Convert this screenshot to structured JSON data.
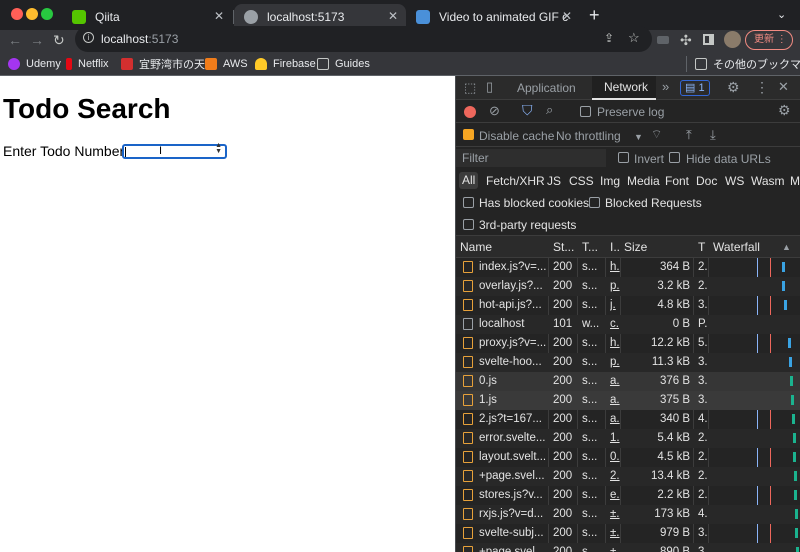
{
  "browser": {
    "tabs": [
      {
        "title": "Qiita",
        "active": false
      },
      {
        "title": "localhost:5173",
        "active": true
      },
      {
        "title": "Video to animated GIF convert",
        "active": false
      }
    ],
    "new_tab": "+",
    "address": {
      "host": "localhost",
      "port": ":5173"
    },
    "update_button": "更新",
    "bookmarks": [
      "Udemy",
      "Netflix",
      "宜野湾市の天気",
      "AWS",
      "Firebase",
      "Guides"
    ],
    "other_bookmarks": "その他のブックマーク"
  },
  "page": {
    "title": "Todo Search",
    "label": "Enter Todo Number:"
  },
  "devtools": {
    "tabs": {
      "application": "Application",
      "network": "Network",
      "more": "»",
      "messages_count": "1"
    },
    "toolbar": {
      "preserve_log": "Preserve log",
      "disable_cache": "Disable cache",
      "throttling": "No throttling"
    },
    "filter": {
      "placeholder": "Filter",
      "invert": "Invert",
      "hide_data_urls": "Hide data URLs"
    },
    "types": [
      "All",
      "Fetch/XHR",
      "JS",
      "CSS",
      "Img",
      "Media",
      "Font",
      "Doc",
      "WS",
      "Wasm",
      "M"
    ],
    "blocked_cookies": "Has blocked cookies",
    "blocked_requests": "Blocked Requests",
    "third_party": "3rd-party requests",
    "columns": {
      "name": "Name",
      "status": "St...",
      "type": "T...",
      "initiator": "I...",
      "size": "Size",
      "time": "T",
      "waterfall": "Waterfall"
    },
    "requests": [
      {
        "name": "index.js?v=...",
        "status": "200",
        "type": "s...",
        "initiator": "h.",
        "size": "364 B",
        "time": "2."
      },
      {
        "name": "overlay.js?...",
        "status": "200",
        "type": "s...",
        "initiator": "p.",
        "size": "3.2 kB",
        "time": "2."
      },
      {
        "name": "hot-api.js?...",
        "status": "200",
        "type": "s...",
        "initiator": "j.",
        "size": "4.8 kB",
        "time": "3."
      },
      {
        "name": "localhost",
        "status": "101",
        "type": "w...",
        "initiator": "c.",
        "size": "0 B",
        "time": "P."
      },
      {
        "name": "proxy.js?v=...",
        "status": "200",
        "type": "s...",
        "initiator": "h.",
        "size": "12.2 kB",
        "time": "5."
      },
      {
        "name": "svelte-hoo...",
        "status": "200",
        "type": "s...",
        "initiator": "p.",
        "size": "11.3 kB",
        "time": "3."
      },
      {
        "name": "0.js",
        "status": "200",
        "type": "s...",
        "initiator": "a.",
        "size": "376 B",
        "time": "3."
      },
      {
        "name": "1.js",
        "status": "200",
        "type": "s...",
        "initiator": "a.",
        "size": "375 B",
        "time": "3."
      },
      {
        "name": "2.js?t=167...",
        "status": "200",
        "type": "s...",
        "initiator": "a.",
        "size": "340 B",
        "time": "4."
      },
      {
        "name": "error.svelte...",
        "status": "200",
        "type": "s...",
        "initiator": "1.",
        "size": "5.4 kB",
        "time": "2."
      },
      {
        "name": "layout.svelt...",
        "status": "200",
        "type": "s...",
        "initiator": "0.",
        "size": "4.5 kB",
        "time": "2."
      },
      {
        "name": "+page.svel...",
        "status": "200",
        "type": "s...",
        "initiator": "2.",
        "size": "13.4 kB",
        "time": "2."
      },
      {
        "name": "stores.js?v...",
        "status": "200",
        "type": "s...",
        "initiator": "e.",
        "size": "2.2 kB",
        "time": "2."
      },
      {
        "name": "rxjs.js?v=d...",
        "status": "200",
        "type": "s...",
        "initiator": "±.",
        "size": "173 kB",
        "time": "4."
      },
      {
        "name": "svelte-subj...",
        "status": "200",
        "type": "s...",
        "initiator": "±.",
        "size": "979 B",
        "time": "3."
      },
      {
        "name": "+page.svel...",
        "status": "200",
        "type": "s...",
        "initiator": "±.",
        "size": "890 B",
        "time": "3."
      }
    ]
  }
}
